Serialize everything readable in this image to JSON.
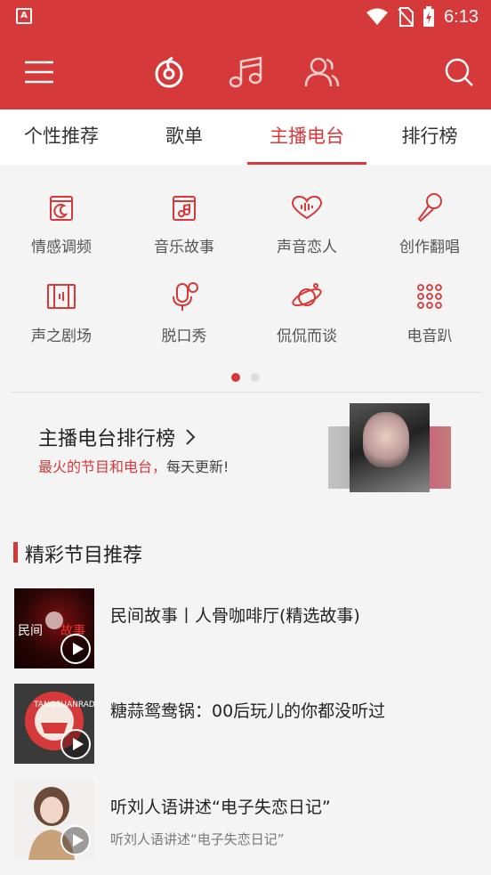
{
  "status_bar": {
    "time": "6:13"
  },
  "tabs": [
    {
      "label": "个性推荐"
    },
    {
      "label": "歌单"
    },
    {
      "label": "主播电台"
    },
    {
      "label": "排行榜"
    }
  ],
  "active_tab": "主播电台",
  "categories": [
    {
      "label": "情感调频",
      "icon": "radio-icon"
    },
    {
      "label": "音乐故事",
      "icon": "music-note-icon"
    },
    {
      "label": "声音恋人",
      "icon": "heart-wave-icon"
    },
    {
      "label": "创作翻唱",
      "icon": "microphone-icon"
    },
    {
      "label": "声之剧场",
      "icon": "film-icon"
    },
    {
      "label": "脱口秀",
      "icon": "talk-mic-icon"
    },
    {
      "label": "侃侃而谈",
      "icon": "planet-icon"
    },
    {
      "label": "电音趴",
      "icon": "dots-grid-icon"
    }
  ],
  "pager": {
    "pages": 2,
    "current": 1
  },
  "rank_banner": {
    "title": "主播电台排行榜",
    "subtitle_highlight": "最火的节目和电台，",
    "subtitle_rest": "每天更新!"
  },
  "section": {
    "title": "精彩节目推荐"
  },
  "programs": [
    {
      "title": "民间故事丨人骨咖啡厅(精选故事)",
      "subtitle": ""
    },
    {
      "title": "糖蒜鸳鸯锅：00后玩儿的你都没听过",
      "subtitle": ""
    },
    {
      "title": "听刘人语讲述“电子失恋日记”",
      "subtitle": "听刘人语讲述“电子失恋日记”"
    }
  ],
  "colors": {
    "brand_red": "#d6393a",
    "text": "#222222",
    "muted": "#777777"
  }
}
